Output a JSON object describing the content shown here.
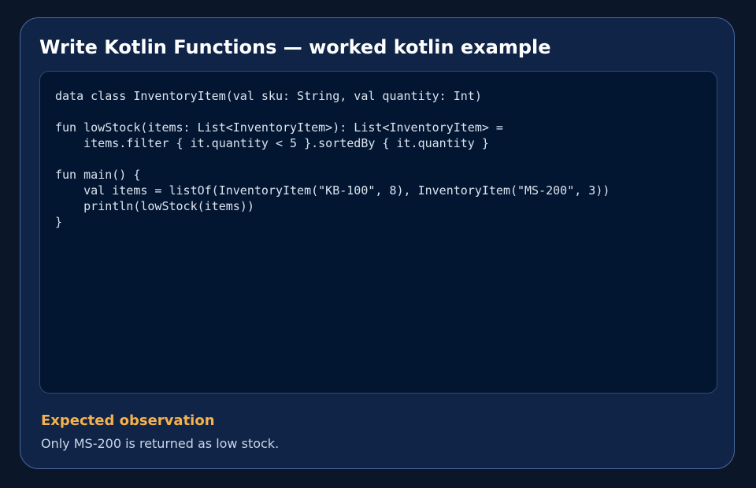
{
  "card": {
    "title": "Write Kotlin Functions — worked kotlin example"
  },
  "code": {
    "language": "kotlin",
    "source": "data class InventoryItem(val sku: String, val quantity: Int)\n\nfun lowStock(items: List<InventoryItem>): List<InventoryItem> =\n    items.filter { it.quantity < 5 }.sortedBy { it.quantity }\n\nfun main() {\n    val items = listOf(InventoryItem(\"KB-100\", 8), InventoryItem(\"MS-200\", 3))\n    println(lowStock(items))\n}"
  },
  "observation": {
    "heading": "Expected observation",
    "text": "Only MS-200 is returned as low stock."
  },
  "colors": {
    "page_background": "#0b1628",
    "card_background": "#0f2447",
    "card_border": "#4a6a9c",
    "code_background": "#031631",
    "title": "#ffffff",
    "code_text": "#dbe3ee",
    "accent_heading": "#f5b14c",
    "body_text": "#c9d6e8"
  }
}
